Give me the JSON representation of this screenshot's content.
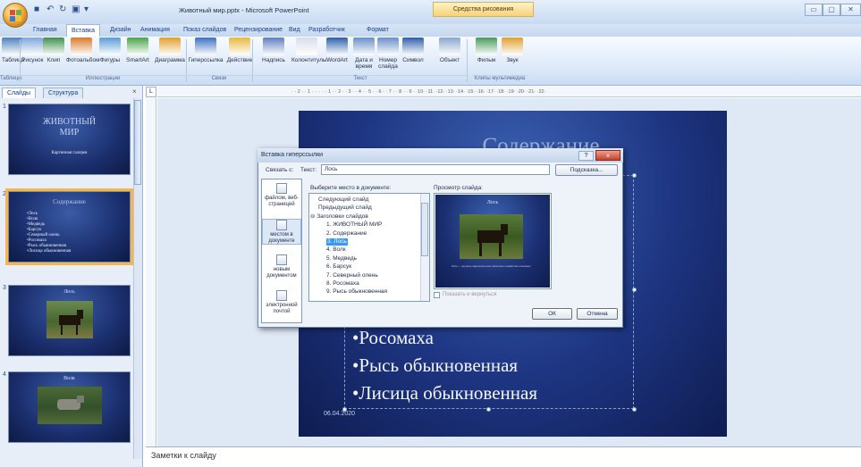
{
  "window": {
    "title": "Животный мир.pptx - Microsoft PowerPoint",
    "contextual_tab": "Средства рисования",
    "quick_access": [
      "save-icon",
      "undo-icon",
      "redo-icon",
      "print-preview-icon",
      "customize-icon"
    ]
  },
  "tabs": [
    "Главная",
    "Вставка",
    "Дизайн",
    "Анимация",
    "Показ слайдов",
    "Рецензирование",
    "Вид",
    "Разработчик",
    "Формат"
  ],
  "active_tab": "Вставка",
  "ribbon": {
    "buttons": [
      {
        "label": "Таблица",
        "icon": "table-icon",
        "color": "#4f81bd"
      },
      {
        "label": "Рисунок",
        "icon": "picture-icon",
        "color": "#7fa7d8"
      },
      {
        "label": "Клип",
        "icon": "clip-icon",
        "color": "#3f8f4f"
      },
      {
        "label": "Фотоальбом",
        "icon": "photo-album-icon",
        "color": "#d87b2a"
      },
      {
        "label": "Фигуры",
        "icon": "shapes-icon",
        "color": "#5b9bd5"
      },
      {
        "label": "SmartArt",
        "icon": "smartart-icon",
        "color": "#4aa44a"
      },
      {
        "label": "Диаграмма",
        "icon": "chart-icon",
        "color": "#e0a030"
      },
      {
        "label": "Гиперссылка",
        "icon": "hyperlink-icon",
        "color": "#3f6fbf"
      },
      {
        "label": "Действие",
        "icon": "action-icon",
        "color": "#e8b840"
      },
      {
        "label": "Надпись",
        "icon": "textbox-icon",
        "color": "#5f7fbf"
      },
      {
        "label": "Колонтитулы",
        "icon": "header-footer-icon",
        "color": "#d8dde8"
      },
      {
        "label": "WordArt",
        "icon": "wordart-icon",
        "color": "#2f5fa8"
      },
      {
        "label": "Дата и время",
        "icon": "date-time-icon",
        "color": "#6a8ec6"
      },
      {
        "label": "Номер слайда",
        "icon": "slide-number-icon",
        "color": "#6a8ec6"
      },
      {
        "label": "Символ",
        "icon": "symbol-icon",
        "color": "#2f5fa8"
      },
      {
        "label": "Объект",
        "icon": "object-icon",
        "color": "#8aa6cc"
      },
      {
        "label": "Фильм",
        "icon": "movie-icon",
        "color": "#4a9a5a"
      },
      {
        "label": "Звук",
        "icon": "sound-icon",
        "color": "#e0a030"
      }
    ],
    "groups": [
      "Таблицы",
      "Иллюстрации",
      "Связи",
      "Текст",
      "Клипы мультимедиа"
    ]
  },
  "left_pane": {
    "tabs": [
      "Слайды",
      "Структура"
    ],
    "close": "×",
    "slides": [
      {
        "num": "1",
        "title": "ЖИВОТНЫЙ МИР",
        "subtitle": "Картинная галерея"
      },
      {
        "num": "2",
        "title": "Содержание",
        "lines": [
          "•Лось",
          "•Волк",
          "•Медведь",
          "•Барсук",
          "•Северный олень",
          "•Росомаха",
          "•Рысь обыкновенная",
          "•Лисица обыкновенная"
        ]
      },
      {
        "num": "3",
        "title": "Лось"
      },
      {
        "num": "4",
        "title": "Волк"
      }
    ]
  },
  "ruler": {
    "top": "· · 2 · · 1 · · ·  · · 1 · · 2 · · 3 · · 4 · · 5 · · 6 · · 7 · · 8 · · 9 · ·10· ·11· ·12· ·13· ·14· ·15· ·16· ·17· ·18· ·19· ·20· ·21· ·22·",
    "corner": "L"
  },
  "slide": {
    "title": "Содержание",
    "bullets": [
      "•Росомаха",
      "•Рысь обыкновенная",
      "•Лисица обыкновенная"
    ],
    "date": "06.04.2020"
  },
  "notes": "Заметки к слайду",
  "dialog": {
    "title": "Вставка гиперссылки",
    "help": "?",
    "close": "×",
    "link_to_label": "Связать с:",
    "text_label": "Текст:",
    "text_value": "Лось",
    "tip_button": "Подсказка...",
    "link_options": [
      "файлом, веб-страницей",
      "местом в документе",
      "новым документом",
      "электронной почтой"
    ],
    "place_label": "Выберите место в документе:",
    "tree": [
      {
        "text": "Следующий слайд",
        "indent": 1
      },
      {
        "text": "Предыдущий слайд",
        "indent": 1
      },
      {
        "text": "⊖ Заголовки слайдов",
        "indent": 0
      },
      {
        "text": "1. ЖИВОТНЫЙ МИР",
        "indent": 2
      },
      {
        "text": "2. Содержание",
        "indent": 2
      },
      {
        "text": "3. Лось",
        "indent": 2,
        "selected": true
      },
      {
        "text": "4. Волк",
        "indent": 2
      },
      {
        "text": "5. Медведь",
        "indent": 2
      },
      {
        "text": "6. Барсук",
        "indent": 2
      },
      {
        "text": "7. Северный олень",
        "indent": 2
      },
      {
        "text": "8. Росомаха",
        "indent": 2
      },
      {
        "text": "9. Рысь обыкновенная",
        "indent": 2
      }
    ],
    "preview_label": "Просмотр слайда:",
    "preview_title": "Лось",
    "preview_caption": "Лось — крупное парнокопытное животное семейства оленевых",
    "show_return": "Показать и вернуться",
    "ok": "ОК",
    "cancel": "Отмена"
  }
}
